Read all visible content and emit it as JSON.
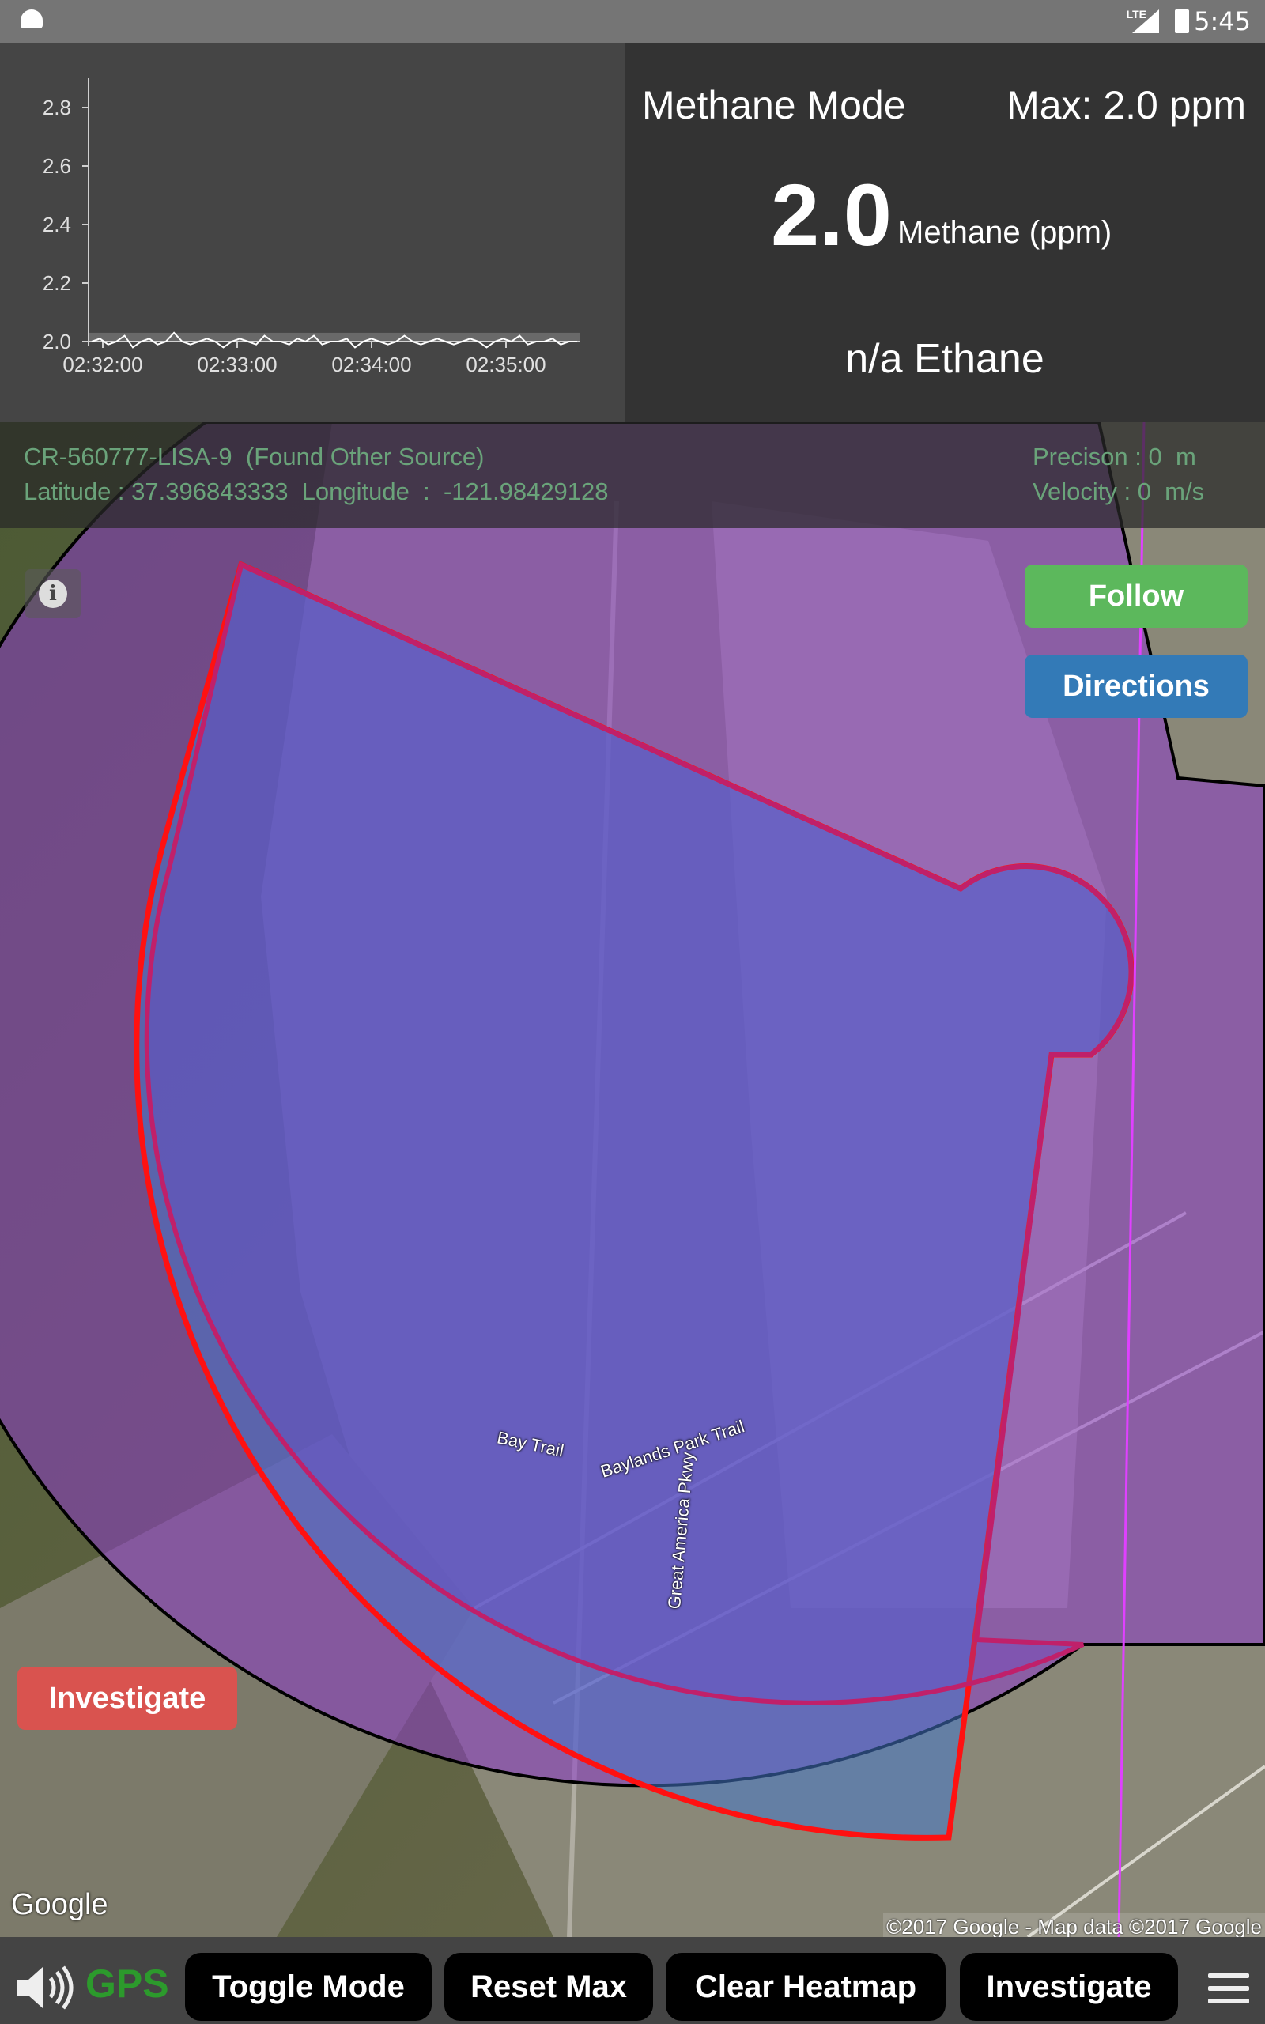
{
  "status_bar": {
    "time": "5:45",
    "network": "LTE"
  },
  "header": {
    "mode_title": "Methane Mode",
    "max_label": "Max: 2.0 ppm",
    "current_value": "2.0",
    "current_unit": "Methane (ppm)",
    "ethane_text": "n/a Ethane"
  },
  "chart_data": {
    "type": "line",
    "x_ticks": [
      "02:32:00",
      "02:33:00",
      "02:34:00",
      "02:35:00"
    ],
    "y_ticks": [
      "2.0",
      "2.2",
      "2.4",
      "2.6",
      "2.8"
    ],
    "ylim": [
      2.0,
      2.9
    ],
    "series": [
      {
        "values": [
          2.0,
          2.01,
          1.99,
          2.0,
          2.02,
          1.98,
          2.0,
          2.01,
          1.99,
          2.0,
          2.03,
          2.0,
          1.99,
          2.0,
          2.01,
          2.0,
          1.98,
          2.0,
          2.01,
          2.0,
          1.99,
          2.02,
          2.0,
          2.0,
          1.99,
          2.01,
          2.0,
          2.02,
          1.99,
          2.0,
          2.0,
          2.01,
          1.98,
          2.0,
          2.01,
          2.0,
          1.99,
          2.0,
          2.02,
          2.0,
          1.99,
          2.0,
          2.01,
          2.0,
          1.99,
          2.0,
          2.01,
          2.0,
          1.98,
          2.0,
          2.01,
          2.0,
          2.02,
          1.99,
          2.0,
          2.0,
          2.01,
          1.99,
          2.0,
          2.0
        ]
      }
    ],
    "grid": false
  },
  "map_info": {
    "source_id": "CR-560777-LISA-9",
    "source_status": "(Found Other Source)",
    "latitude_label": "Latitude :",
    "latitude_value": "37.396843333",
    "longitude_label": "Longitude  :",
    "longitude_value": "-121.98429128",
    "precision_label": "Precison :",
    "precision_value": "0",
    "precision_unit": "m",
    "velocity_label": "Velocity :",
    "velocity_value": "0",
    "velocity_unit": "m/s"
  },
  "map": {
    "follow_label": "Follow",
    "directions_label": "Directions",
    "investigate_label": "Investigate",
    "google_logo": "Google",
    "copyright": "©2017 Google - Map data ©2017 Google",
    "road_labels": {
      "great_america": "Great America Pkwy",
      "bay_trail": "Bay Trail",
      "baylands": "Baylands Park Trail"
    }
  },
  "toolbar": {
    "gps_label": "GPS",
    "toggle_mode": "Toggle Mode",
    "reset_max": "Reset Max",
    "clear_heatmap": "Clear Heatmap",
    "investigate": "Investigate"
  },
  "colors": {
    "follow": "#5cb85c",
    "directions": "#337ab7",
    "investigate": "#d9534f",
    "gps": "#2c9a2c"
  }
}
